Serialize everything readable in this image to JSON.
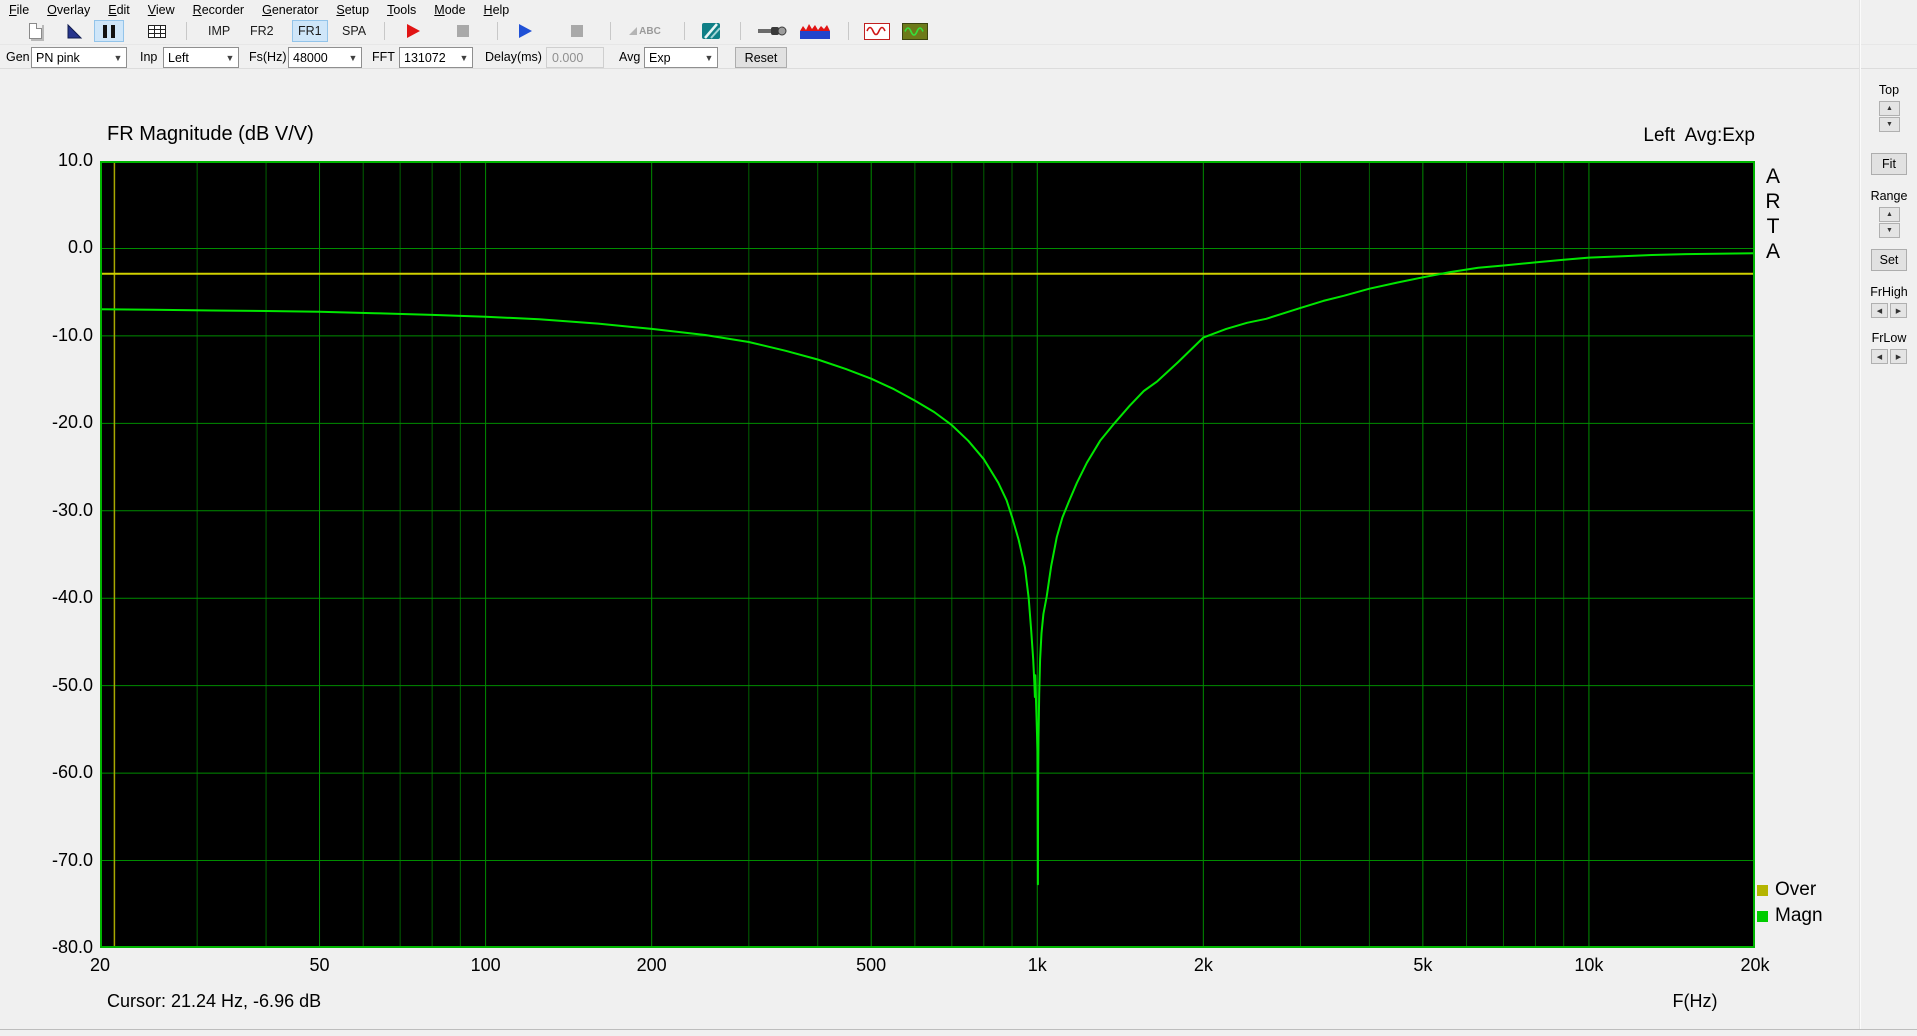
{
  "menu": {
    "items": [
      "File",
      "Overlay",
      "Edit",
      "View",
      "Recorder",
      "Generator",
      "Setup",
      "Tools",
      "Mode",
      "Help"
    ]
  },
  "toolbar": {
    "mode_buttons": [
      {
        "label": "IMP",
        "active": false
      },
      {
        "label": "FR2",
        "active": false
      },
      {
        "label": "FR1",
        "active": true
      },
      {
        "label": "SPA",
        "active": false
      }
    ],
    "abc_label": "ABC"
  },
  "controls": {
    "gen": {
      "label": "Gen",
      "value": "PN pink"
    },
    "inp": {
      "label": "Inp",
      "value": "Left"
    },
    "fs": {
      "label": "Fs(Hz)",
      "value": "48000"
    },
    "fft": {
      "label": "FFT",
      "value": "131072"
    },
    "delay": {
      "label": "Delay(ms)",
      "value": "0.000"
    },
    "avg": {
      "label": "Avg",
      "value": "Exp"
    },
    "reset_label": "Reset"
  },
  "right_panel": {
    "top_label": "Top",
    "fit_label": "Fit",
    "range_label": "Range",
    "set_label": "Set",
    "frhigh_label": "FrHigh",
    "frlow_label": "FrLow"
  },
  "chart_data": {
    "type": "line",
    "title": "FR Magnitude (dB V/V)",
    "corner_label": "Left  Avg:Exp",
    "watermark": "ARTA",
    "xlabel": "F(Hz)",
    "x_scale": "log",
    "x_range": [
      20,
      20000
    ],
    "y_range": [
      -80,
      10
    ],
    "grid": true,
    "x_ticks": [
      {
        "f": 20,
        "label": "20"
      },
      {
        "f": 50,
        "label": "50"
      },
      {
        "f": 100,
        "label": "100"
      },
      {
        "f": 200,
        "label": "200"
      },
      {
        "f": 500,
        "label": "500"
      },
      {
        "f": 1000,
        "label": "1k"
      },
      {
        "f": 2000,
        "label": "2k"
      },
      {
        "f": 5000,
        "label": "5k"
      },
      {
        "f": 10000,
        "label": "10k"
      },
      {
        "f": 20000,
        "label": "20k"
      }
    ],
    "x_minor": [
      30,
      40,
      60,
      70,
      80,
      90,
      300,
      400,
      600,
      700,
      800,
      900,
      3000,
      4000,
      6000,
      7000,
      8000,
      9000
    ],
    "y_ticks": [
      {
        "db": 10,
        "label": "10.0"
      },
      {
        "db": 0,
        "label": "0.0"
      },
      {
        "db": -10,
        "label": "-10.0"
      },
      {
        "db": -20,
        "label": "-20.0"
      },
      {
        "db": -30,
        "label": "-30.0"
      },
      {
        "db": -40,
        "label": "-40.0"
      },
      {
        "db": -50,
        "label": "-50.0"
      },
      {
        "db": -60,
        "label": "-60.0"
      },
      {
        "db": -70,
        "label": "-70.0"
      },
      {
        "db": -80,
        "label": "-80.0"
      }
    ],
    "cursor": {
      "hz": 21.24,
      "db": -6.96,
      "text": "Cursor: 21.24 Hz, -6.96 dB"
    },
    "series": [
      {
        "name": "Over",
        "type": "hline",
        "value_db": -2.9,
        "color": "#d0d000"
      },
      {
        "name": "Magn",
        "type": "curve",
        "color": "#00e600",
        "points": [
          [
            20,
            -6.96
          ],
          [
            25,
            -7.0
          ],
          [
            32,
            -7.1
          ],
          [
            40,
            -7.15
          ],
          [
            50,
            -7.25
          ],
          [
            63,
            -7.4
          ],
          [
            80,
            -7.6
          ],
          [
            100,
            -7.8
          ],
          [
            125,
            -8.1
          ],
          [
            160,
            -8.6
          ],
          [
            200,
            -9.2
          ],
          [
            250,
            -9.9
          ],
          [
            300,
            -10.7
          ],
          [
            350,
            -11.7
          ],
          [
            400,
            -12.7
          ],
          [
            450,
            -13.8
          ],
          [
            500,
            -14.9
          ],
          [
            550,
            -16.1
          ],
          [
            600,
            -17.4
          ],
          [
            650,
            -18.7
          ],
          [
            700,
            -20.2
          ],
          [
            750,
            -22.0
          ],
          [
            800,
            -24.1
          ],
          [
            850,
            -26.8
          ],
          [
            880,
            -28.8
          ],
          [
            900,
            -30.7
          ],
          [
            925,
            -33.3
          ],
          [
            950,
            -36.5
          ],
          [
            965,
            -40.0
          ],
          [
            975,
            -43.7
          ],
          [
            983,
            -47.0
          ],
          [
            988,
            -49.8
          ],
          [
            990,
            -51.3
          ],
          [
            991.5,
            -48.8
          ],
          [
            994,
            -51.0
          ],
          [
            997,
            -53.5
          ],
          [
            999,
            -55.5
          ],
          [
            1000.5,
            -57.5
          ],
          [
            1001.5,
            -63.0
          ],
          [
            1002.5,
            -72.7
          ],
          [
            1003.5,
            -62.0
          ],
          [
            1005,
            -56.0
          ],
          [
            1008,
            -51.0
          ],
          [
            1012,
            -47.0
          ],
          [
            1018,
            -44.0
          ],
          [
            1026,
            -41.8
          ],
          [
            1040,
            -39.8
          ],
          [
            1060,
            -36.3
          ],
          [
            1085,
            -33.0
          ],
          [
            1110,
            -30.8
          ],
          [
            1140,
            -29.0
          ],
          [
            1180,
            -26.8
          ],
          [
            1230,
            -24.5
          ],
          [
            1300,
            -22.0
          ],
          [
            1380,
            -20.0
          ],
          [
            1470,
            -18.0
          ],
          [
            1560,
            -16.3
          ],
          [
            1650,
            -15.2
          ],
          [
            1800,
            -13.0
          ],
          [
            2000,
            -10.2
          ],
          [
            2200,
            -9.2
          ],
          [
            2400,
            -8.5
          ],
          [
            2600,
            -8.05
          ],
          [
            2800,
            -7.4
          ],
          [
            3000,
            -6.8
          ],
          [
            3300,
            -6.0
          ],
          [
            3600,
            -5.4
          ],
          [
            4000,
            -4.6
          ],
          [
            4500,
            -3.9
          ],
          [
            5000,
            -3.3
          ],
          [
            5600,
            -2.7
          ],
          [
            6300,
            -2.2
          ],
          [
            7000,
            -1.95
          ],
          [
            8000,
            -1.6
          ],
          [
            9000,
            -1.3
          ],
          [
            10000,
            -1.05
          ],
          [
            11500,
            -0.9
          ],
          [
            13000,
            -0.75
          ],
          [
            15000,
            -0.65
          ],
          [
            17000,
            -0.6
          ],
          [
            20000,
            -0.55
          ]
        ]
      }
    ],
    "legend": [
      {
        "label": "Over",
        "color": "#b4b400"
      },
      {
        "label": "Magn",
        "color": "#00cc00"
      }
    ],
    "colors": {
      "plot_bg": "#000000",
      "border": "#00b400",
      "grid_major": "#008c00",
      "grid_minor": "#006000",
      "cursor_line": "#a8a800"
    }
  }
}
